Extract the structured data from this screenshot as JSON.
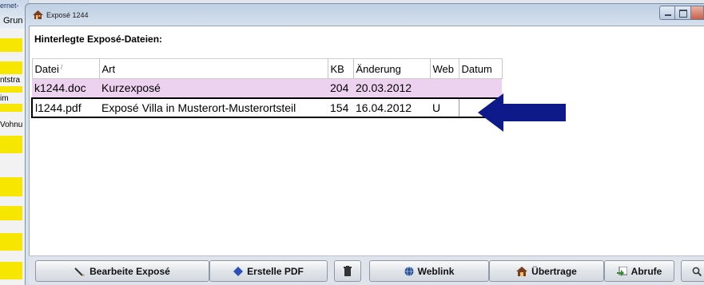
{
  "background_app": {
    "top_text": "ernet-",
    "title": "Grun",
    "side_labels": [
      "ntstra",
      "im",
      "Vohnu"
    ]
  },
  "window": {
    "title": "Exposé 1244"
  },
  "section_title": "Hinterlegte Exposé-Dateien:",
  "table": {
    "headers": [
      "Datei",
      "Art",
      "KB",
      "Änderung",
      "Web",
      "Datum"
    ],
    "rows": [
      {
        "datei": "k1244.doc",
        "art": "Kurzexposé",
        "kb": "204",
        "aenderung": "20.03.2012",
        "web": "",
        "datum": ""
      },
      {
        "datei": "l1244.pdf",
        "art": "Exposé Villa in Musterort-Musterortsteil",
        "kb": "154",
        "aenderung": "16.04.2012",
        "web": "U",
        "datum": ""
      }
    ]
  },
  "buttons": {
    "edit": "Bearbeite Exposé",
    "pdf": "Erstelle PDF",
    "weblink": "Weblink",
    "transfer": "Übertrage",
    "retrieve": "Abrufe"
  },
  "colors": {
    "row_highlight": "#ecd2ee",
    "arrow": "#0f1a8a",
    "background_highlight": "#f6e600"
  }
}
